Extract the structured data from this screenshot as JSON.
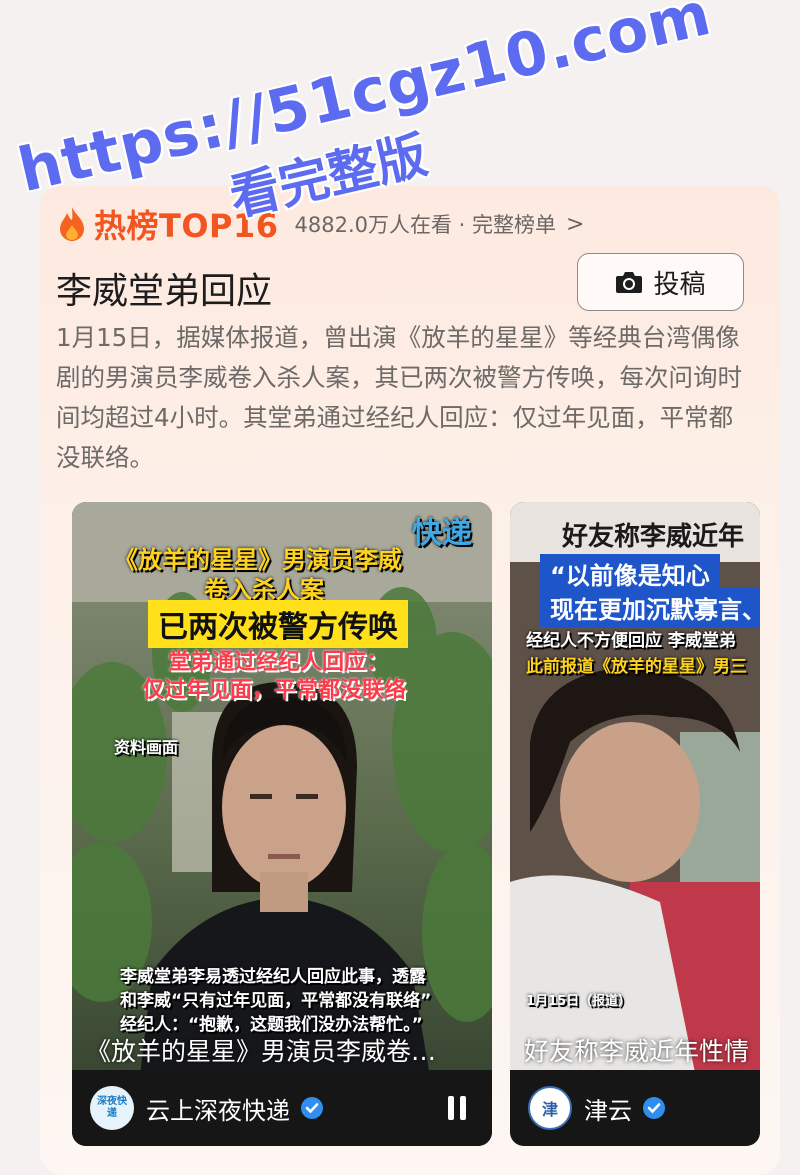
{
  "watermark": {
    "line1": "https://51cgz10.com",
    "line2": "看完整版"
  },
  "hot": {
    "title": "热榜TOP16",
    "meta": "4882.0万人在看 · 完整榜单",
    "chevron": ">"
  },
  "topic": {
    "title": "李威堂弟回应",
    "submit_label": "投稿"
  },
  "description": "1月15日，据媒体报道，曾出演《放羊的星星》等经典台湾偶像剧的男演员李威卷入杀人案，其已两次被警方传唤，每次问询时间均超过4小时。其堂弟通过经纪人回应：仅过年见面，平常都没联络。",
  "videos": [
    {
      "brand": "快递",
      "headline1": "《放羊的星星》男演员李威",
      "headline2": "卷入杀人案",
      "banner": "已两次被警方传唤",
      "sub1": "堂弟通过经纪人回应：",
      "sub2": "仅过年见面，平常都没联络",
      "tag": "资料画面",
      "cap1": "李威堂弟李易透过经纪人回应此事，透露",
      "cap2": "和李威“只有过年见面，平常都没有联络”",
      "cap3": "经纪人：“抱歉，这题我们没办法帮忙。”",
      "title": "《放羊的星星》男演员李威卷…",
      "author": "云上深夜快递",
      "avatar_text": "深夜快递",
      "pause_icon": "pause-icon"
    },
    {
      "headline": "好友称李威近年",
      "quote1": "“以前像是知心",
      "quote2": "现在更加沉默寡言、",
      "sub1": "经纪人不方便回应 李威堂弟",
      "sub2": "此前报道《放羊的星星》男三",
      "date": "1月15日（报道）",
      "title": "好友称李威近年性情",
      "author": "津云",
      "avatar_text": "津"
    }
  ],
  "colors": {
    "accent": "#f2551f",
    "watermark": "#5c6bf0",
    "verified": "#2e8ff0"
  }
}
